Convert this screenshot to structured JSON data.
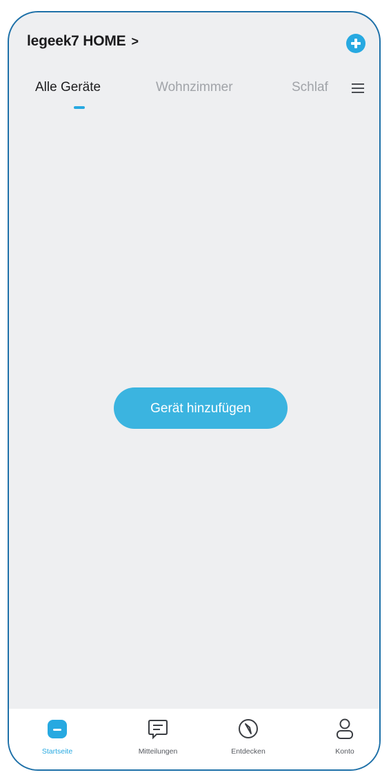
{
  "header": {
    "home_title": "legeek7 HOME",
    "home_chevron": ">"
  },
  "tabs": [
    {
      "label": "Alle Geräte"
    },
    {
      "label": "Wohnzimmer"
    },
    {
      "label": "Schlaf"
    }
  ],
  "main": {
    "add_device_label": "Gerät hinzufügen"
  },
  "tabbar": [
    {
      "label": "Startseite",
      "icon": "home-icon"
    },
    {
      "label": "Mitteilungen",
      "icon": "message-icon"
    },
    {
      "label": "Entdecken",
      "icon": "compass-icon"
    },
    {
      "label": "Konto",
      "icon": "user-icon"
    }
  ],
  "colors": {
    "accent": "#27a9e1",
    "button": "#3bb4e0",
    "background": "#eeeff1",
    "frame": "#1d70a8"
  }
}
